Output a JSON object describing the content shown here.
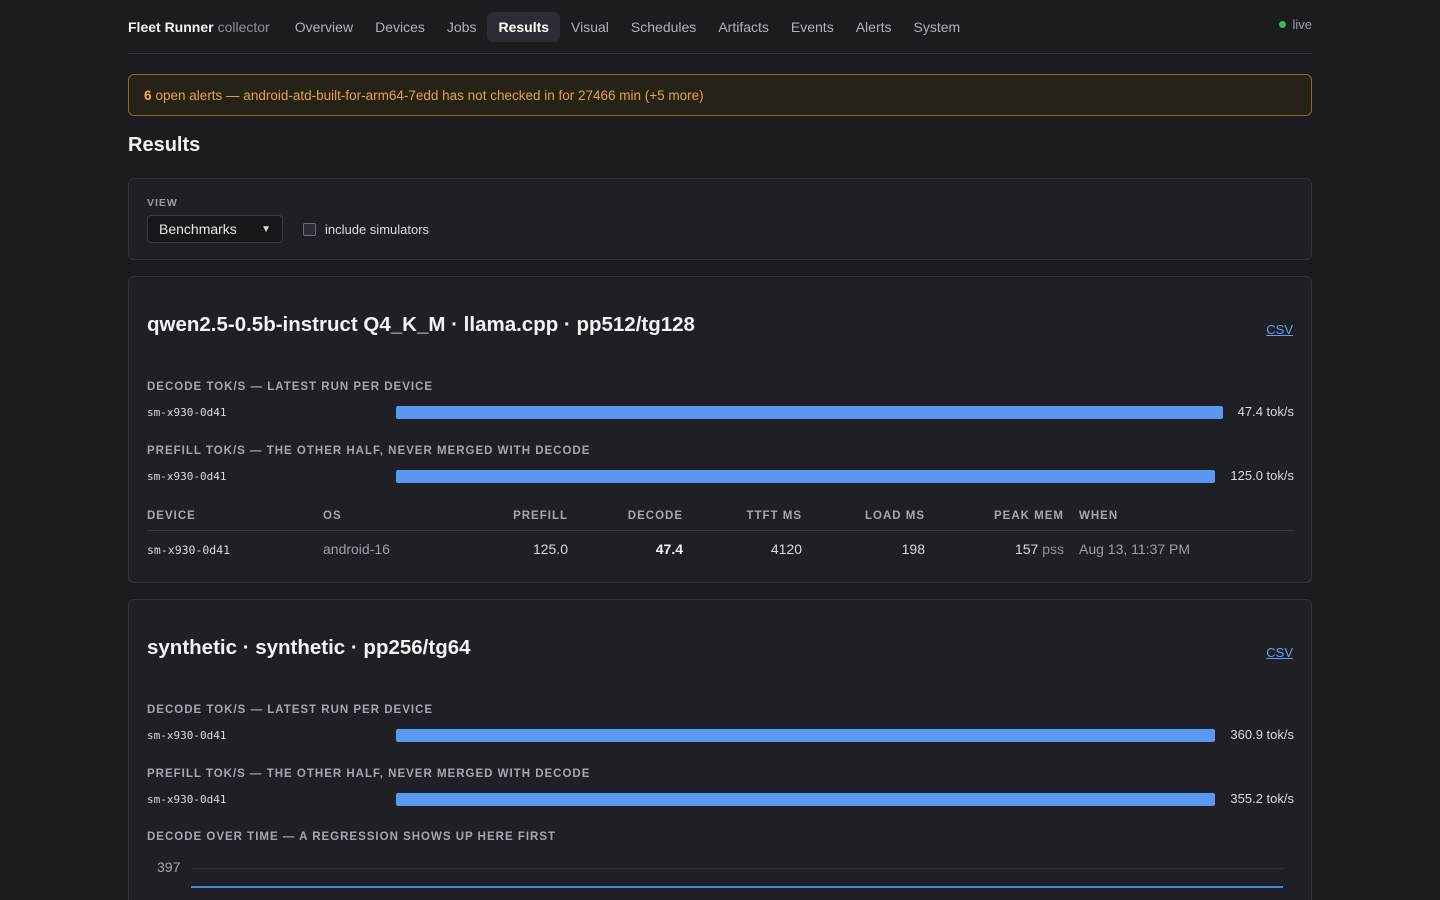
{
  "app": {
    "name": "Fleet Runner",
    "sub": "collector",
    "status": "live"
  },
  "nav": [
    "Overview",
    "Devices",
    "Jobs",
    "Results",
    "Visual",
    "Schedules",
    "Artifacts",
    "Events",
    "Alerts",
    "System"
  ],
  "nav_active": "Results",
  "alert": {
    "count": "6",
    "text": "open alerts — android-atd-built-for-arm64-7edd has not checked in for 27466 min (+5 more)"
  },
  "page_title": "Results",
  "view": {
    "label": "VIEW",
    "selected": "Benchmarks",
    "include_simulators_label": "include simulators",
    "include_simulators": false
  },
  "cards": [
    {
      "title": "qwen2.5-0.5b-instruct Q4_K_M · llama.cpp · pp512/tg128",
      "csv": "CSV",
      "decode_label": "DECODE TOK/S — LATEST RUN PER DEVICE",
      "decode": {
        "device": "sm-x930-0d41",
        "value_text": "47.4 tok/s",
        "fraction": 1.0
      },
      "prefill_label": "PREFILL TOK/S — THE OTHER HALF, NEVER MERGED WITH DECODE",
      "prefill": {
        "device": "sm-x930-0d41",
        "value_text": "125.0 tok/s",
        "fraction": 1.0
      },
      "table": {
        "headers": [
          "DEVICE",
          "OS",
          "PREFILL",
          "DECODE",
          "TTFT MS",
          "LOAD MS",
          "PEAK MEM",
          "WHEN"
        ],
        "rows": [
          {
            "device": "sm-x930-0d41",
            "os": "android-16",
            "prefill": "125.0",
            "decode": "47.4",
            "ttft": "4120",
            "load": "198",
            "peak_mem": "157",
            "peak_unit": "pss",
            "when": "Aug 13, 11:37 PM"
          }
        ]
      }
    },
    {
      "title": "synthetic · synthetic · pp256/tg64",
      "csv": "CSV",
      "decode_label": "DECODE TOK/S — LATEST RUN PER DEVICE",
      "decode": {
        "device": "sm-x930-0d41",
        "value_text": "360.9 tok/s",
        "fraction": 1.0
      },
      "prefill_label": "PREFILL TOK/S — THE OTHER HALF, NEVER MERGED WITH DECODE",
      "prefill": {
        "device": "sm-x930-0d41",
        "value_text": "355.2 tok/s",
        "fraction": 1.0
      },
      "over_time_label": "DECODE OVER TIME — A REGRESSION SHOWS UP HERE FIRST",
      "over_time_ymax": "397"
    }
  ],
  "colors": {
    "accent": "#5b96f0",
    "alert": "#e0a54a",
    "live": "#3fb950"
  }
}
